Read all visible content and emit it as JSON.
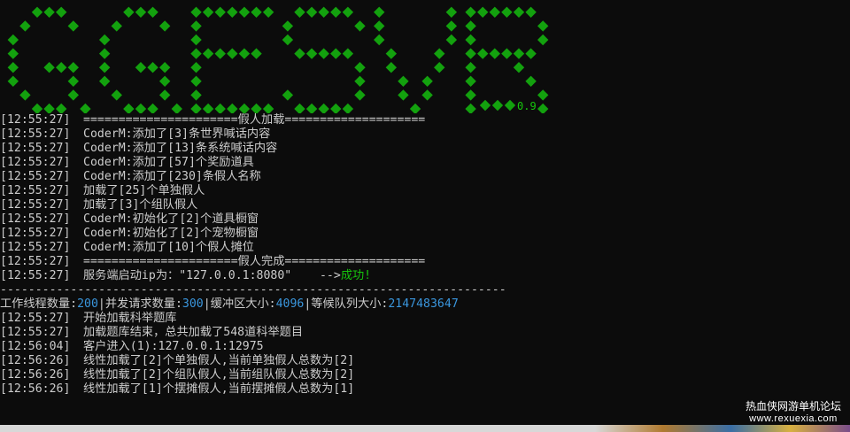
{
  "banner": {
    "text": "GGESVR",
    "version": "0.9",
    "dot_color": "#13a10e"
  },
  "colors": {
    "background": "#0c0c0c",
    "text": "#cccccc",
    "number": "#3a96dd",
    "success": "#16c60c"
  },
  "log_top": [
    {
      "ts": "[12:55:27]",
      "msg": "======================假人加载===================="
    },
    {
      "ts": "[12:55:27]",
      "msg": "CoderM:添加了[3]条世界喊话内容"
    },
    {
      "ts": "[12:55:27]",
      "msg": "CoderM:添加了[13]条系统喊话内容"
    },
    {
      "ts": "[12:55:27]",
      "msg": "CoderM:添加了[57]个奖励道具"
    },
    {
      "ts": "[12:55:27]",
      "msg": "CoderM:添加了[230]条假人名称"
    },
    {
      "ts": "[12:55:27]",
      "msg": "加载了[25]个单独假人"
    },
    {
      "ts": "[12:55:27]",
      "msg": "加载了[3]个组队假人"
    },
    {
      "ts": "[12:55:27]",
      "msg": "CoderM:初始化了[2]个道具橱窗"
    },
    {
      "ts": "[12:55:27]",
      "msg": "CoderM:初始化了[2]个宠物橱窗"
    },
    {
      "ts": "[12:55:27]",
      "msg": "CoderM:添加了[10]个假人摊位"
    },
    {
      "ts": "[12:55:27]",
      "msg": "======================假人完成===================="
    }
  ],
  "server_start": {
    "ts": "[12:55:27]",
    "msg": "服务端启动ip为：\"127.0.0.1:8080\"    -->",
    "status": "成功!"
  },
  "separator": "------------------------------------------------------------------------",
  "stats": {
    "threads_label": "工作线程数量:",
    "threads": "200",
    "concurrent_label": "|并发请求数量:",
    "concurrent": "300",
    "buffer_label": "|缓冲区大小:",
    "buffer": "4096",
    "queue_label": "|等候队列大小:",
    "queue": "2147483647"
  },
  "log_bottom": [
    {
      "ts": "[12:55:27]",
      "msg": "开始加载科举题库"
    },
    {
      "ts": "[12:55:27]",
      "msg": "加载题库结束，总共加载了548道科举题目"
    },
    {
      "ts": "[12:56:04]",
      "msg": "客户进入(1):127.0.0.1:12975"
    },
    {
      "ts": "[12:56:26]",
      "msg": "线性加载了[2]个单独假人,当前单独假人总数为[2]"
    },
    {
      "ts": "[12:56:26]",
      "msg": "线性加载了[2]个组队假人,当前组队假人总数为[2]"
    },
    {
      "ts": "[12:56:26]",
      "msg": "线性加载了[1]个摆摊假人,当前摆摊假人总数为[1]"
    }
  ],
  "watermark": {
    "title": "热血侠网游单机论坛",
    "site": "www.rexuexia.com"
  }
}
